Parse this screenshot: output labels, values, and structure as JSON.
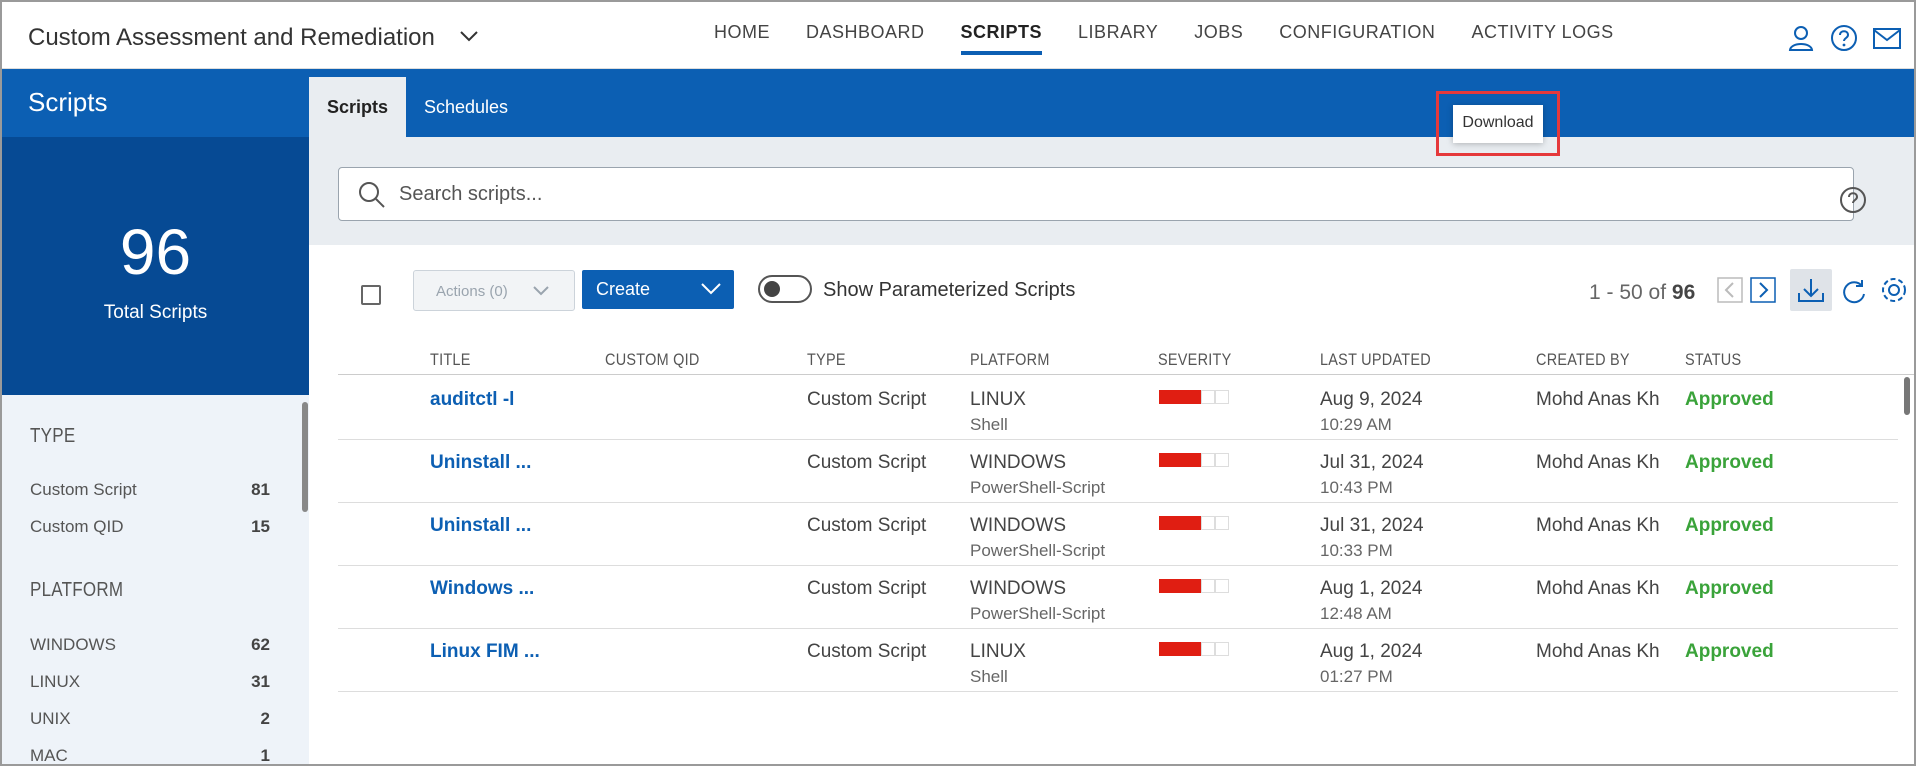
{
  "header": {
    "app_title": "Custom Assessment and Remediation",
    "nav": [
      "HOME",
      "DASHBOARD",
      "SCRIPTS",
      "LIBRARY",
      "JOBS",
      "CONFIGURATION",
      "ACTIVITY LOGS"
    ],
    "active_nav": "SCRIPTS",
    "icons": [
      "user-icon",
      "help-icon",
      "mail-icon"
    ]
  },
  "sidebar": {
    "title": "Scripts",
    "total": "96",
    "total_label": "Total Scripts",
    "sections": [
      {
        "heading": "TYPE",
        "items": [
          {
            "label": "Custom Script",
            "count": "81"
          },
          {
            "label": "Custom QID",
            "count": "15"
          }
        ]
      },
      {
        "heading": "PLATFORM",
        "items": [
          {
            "label": "WINDOWS",
            "count": "62"
          },
          {
            "label": "LINUX",
            "count": "31"
          },
          {
            "label": "UNIX",
            "count": "2"
          },
          {
            "label": "MAC",
            "count": "1"
          }
        ]
      }
    ]
  },
  "tabs": [
    "Scripts",
    "Schedules"
  ],
  "search": {
    "placeholder": "Search scripts..."
  },
  "toolbar": {
    "actions_label": "Actions (0)",
    "create_label": "Create",
    "toggle_label": "Show Parameterized Scripts",
    "pager_range": "1 - 50 of",
    "pager_total": "96",
    "tooltip": "Download"
  },
  "table": {
    "columns": [
      "TITLE",
      "CUSTOM QID",
      "TYPE",
      "PLATFORM",
      "SEVERITY",
      "LAST UPDATED",
      "CREATED BY",
      "STATUS"
    ],
    "rows": [
      {
        "title": "auditctl -l",
        "qid": "",
        "type": "Custom Script",
        "platform": "LINUX",
        "platform_sub": "Shell",
        "severity": 3,
        "date": "Aug 9, 2024",
        "time": "10:29 AM",
        "created_by": "Mohd Anas Kh",
        "status": "Approved"
      },
      {
        "title": "Uninstall ...",
        "qid": "",
        "type": "Custom Script",
        "platform": "WINDOWS",
        "platform_sub": "PowerShell-Script",
        "severity": 3,
        "date": "Jul 31, 2024",
        "time": "10:43 PM",
        "created_by": "Mohd Anas Kh",
        "status": "Approved"
      },
      {
        "title": "Uninstall ...",
        "qid": "",
        "type": "Custom Script",
        "platform": "WINDOWS",
        "platform_sub": "PowerShell-Script",
        "severity": 3,
        "date": "Jul 31, 2024",
        "time": "10:33 PM",
        "created_by": "Mohd Anas Kh",
        "status": "Approved"
      },
      {
        "title": "Windows ...",
        "qid": "",
        "type": "Custom Script",
        "platform": "WINDOWS",
        "platform_sub": "PowerShell-Script",
        "severity": 3,
        "date": "Aug 1, 2024",
        "time": "12:48 AM",
        "created_by": "Mohd Anas Kh",
        "status": "Approved"
      },
      {
        "title": "Linux FIM ...",
        "qid": "",
        "type": "Custom Script",
        "platform": "LINUX",
        "platform_sub": "Shell",
        "severity": 3,
        "date": "Aug 1, 2024",
        "time": "01:27 PM",
        "created_by": "Mohd Anas Kh",
        "status": "Approved"
      }
    ],
    "severity_max": 5
  },
  "colors": {
    "brand_blue": "#0c5fb3",
    "dark_blue": "#064a94",
    "severity_red": "#e01e12",
    "approved_green": "#3aa33a",
    "highlight_red": "#e5393b"
  }
}
